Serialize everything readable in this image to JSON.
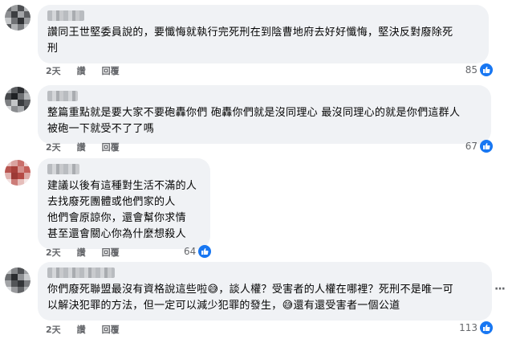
{
  "comments": [
    {
      "lines": [
        "讚同王世堅委員說的，要懺悔就執行完死刑在到陰曹地府去好好懺悔，堅決反對廢除死",
        "刑"
      ],
      "time": "2天",
      "like_label": "讚",
      "reply_label": "回覆",
      "reactions": "85"
    },
    {
      "lines": [
        "整篇重點就是要大家不要砲轟你們 砲轟你們就是沒同理心 最沒同理心的就是你們這群人",
        "被砲一下就受不了了嗎"
      ],
      "time": "2天",
      "like_label": "讚",
      "reply_label": "回覆",
      "reactions": "67"
    },
    {
      "lines": [
        "建議以後有這種對生活不滿的人",
        "去找廢死團體或他們家的人",
        "他們會原諒你，還會幫你求情",
        "甚至還會關心你為什麼想殺人"
      ],
      "time": "2天",
      "like_label": "讚",
      "reply_label": "回覆",
      "reactions": "64"
    },
    {
      "lines": [
        "你們廢死聯盟最沒有資格說這些啦😅，談人權？受害者的人權在哪裡？死刑不是唯一可",
        "以解決犯罪的方法，但一定可以減少犯罪的發生，😅還有還受害者一個公道"
      ],
      "time": "2天",
      "like_label": "讚",
      "reply_label": "回覆",
      "reactions": "113"
    }
  ],
  "colors": {
    "bubble": "#f0f2f5",
    "like_blue": "#1877f2",
    "meta_gray": "#65676b"
  },
  "icons": {
    "like": "thumbs-up-icon",
    "more": "more-options-icon"
  }
}
